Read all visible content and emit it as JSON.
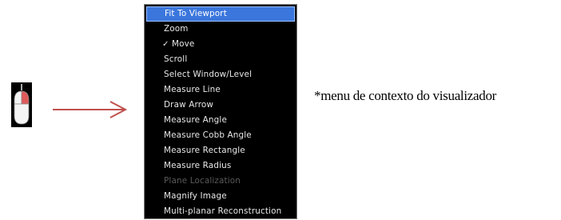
{
  "context_menu": {
    "items": [
      {
        "label": "Fit To Viewport",
        "state": "highlighted"
      },
      {
        "label": "Zoom",
        "state": "normal"
      },
      {
        "label": "Move",
        "state": "checked",
        "check_mark": "✓"
      },
      {
        "label": "Scroll",
        "state": "normal"
      },
      {
        "label": "Select Window/Level",
        "state": "normal"
      },
      {
        "label": "Measure Line",
        "state": "normal"
      },
      {
        "label": "Draw Arrow",
        "state": "normal"
      },
      {
        "label": "Measure Angle",
        "state": "normal"
      },
      {
        "label": "Measure Cobb Angle",
        "state": "normal"
      },
      {
        "label": "Measure Rectangle",
        "state": "normal"
      },
      {
        "label": "Measure Radius",
        "state": "normal"
      },
      {
        "label": "Plane Localization",
        "state": "disabled"
      },
      {
        "label": "Magnify Image",
        "state": "normal"
      },
      {
        "label": "Multi-planar Reconstruction",
        "state": "normal"
      }
    ]
  },
  "caption": "*menu de contexto do visualizador",
  "icons": {
    "mouse": "mouse-right-click-icon",
    "arrow": "right-arrow-icon"
  },
  "colors": {
    "menu_bg": "#000000",
    "highlight": "#3a76dc",
    "arrow": "#c0504d",
    "mouse_button": "#e05a5a"
  }
}
